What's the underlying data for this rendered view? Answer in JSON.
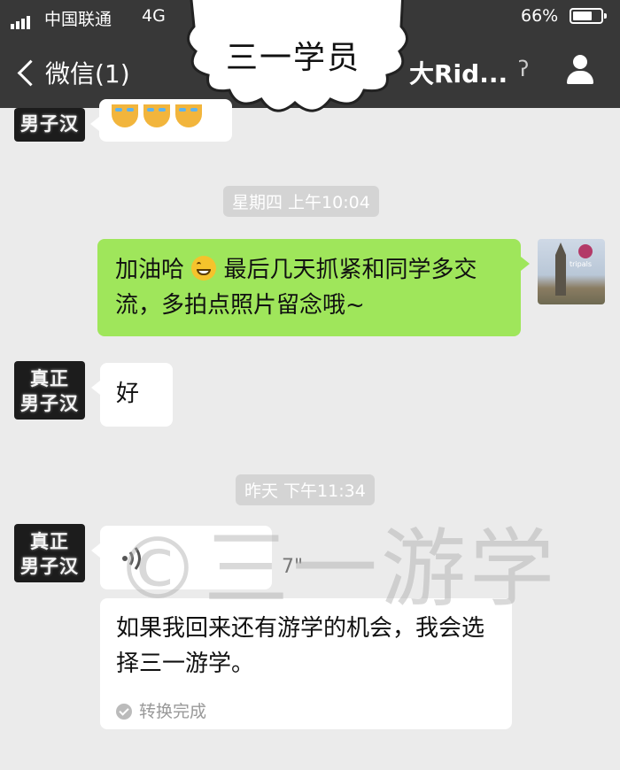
{
  "status_bar": {
    "carrier": "中国联通",
    "network": "4G",
    "battery_percent": "66%",
    "battery_level": 0.66,
    "signal_bars": 4
  },
  "nav": {
    "back_label": "微信(1)",
    "title_visible_tail": "大Rid...",
    "icons": [
      "chevron-left-icon",
      "ear-icon",
      "person-icon"
    ]
  },
  "overlay_label": "三一学员",
  "messages": {
    "m1": {
      "sender": "other",
      "content": "emoji",
      "icon": "crying-emoji-icon",
      "emoji_count": 3
    },
    "t1": "星期四 上午10:04",
    "m2": {
      "sender": "self",
      "text_part1": "加油哈",
      "text_part2": "最后几天抓紧和同学多交流，多拍点照片留念哦~",
      "icon": "grin-emoji-icon"
    },
    "m3": {
      "sender": "other",
      "text": "好"
    },
    "t2": "昨天 下午11:34",
    "m4": {
      "sender": "other",
      "type": "voice",
      "duration": "7\"",
      "icon": "voice-wave-icon"
    },
    "m5": {
      "sender": "other",
      "type": "transcript",
      "text": "如果我回来还有游学的机会，我会选择三一游学。",
      "status": "转换完成"
    }
  },
  "avatar_other": {
    "line1": "真正",
    "line2": "男子汉"
  },
  "self_avatar_badge": "tripals",
  "watermark": "©三一游学",
  "colors": {
    "header": "#383838",
    "background": "#ebebeb",
    "self_bubble": "#9fe65b",
    "other_bubble": "#ffffff"
  }
}
